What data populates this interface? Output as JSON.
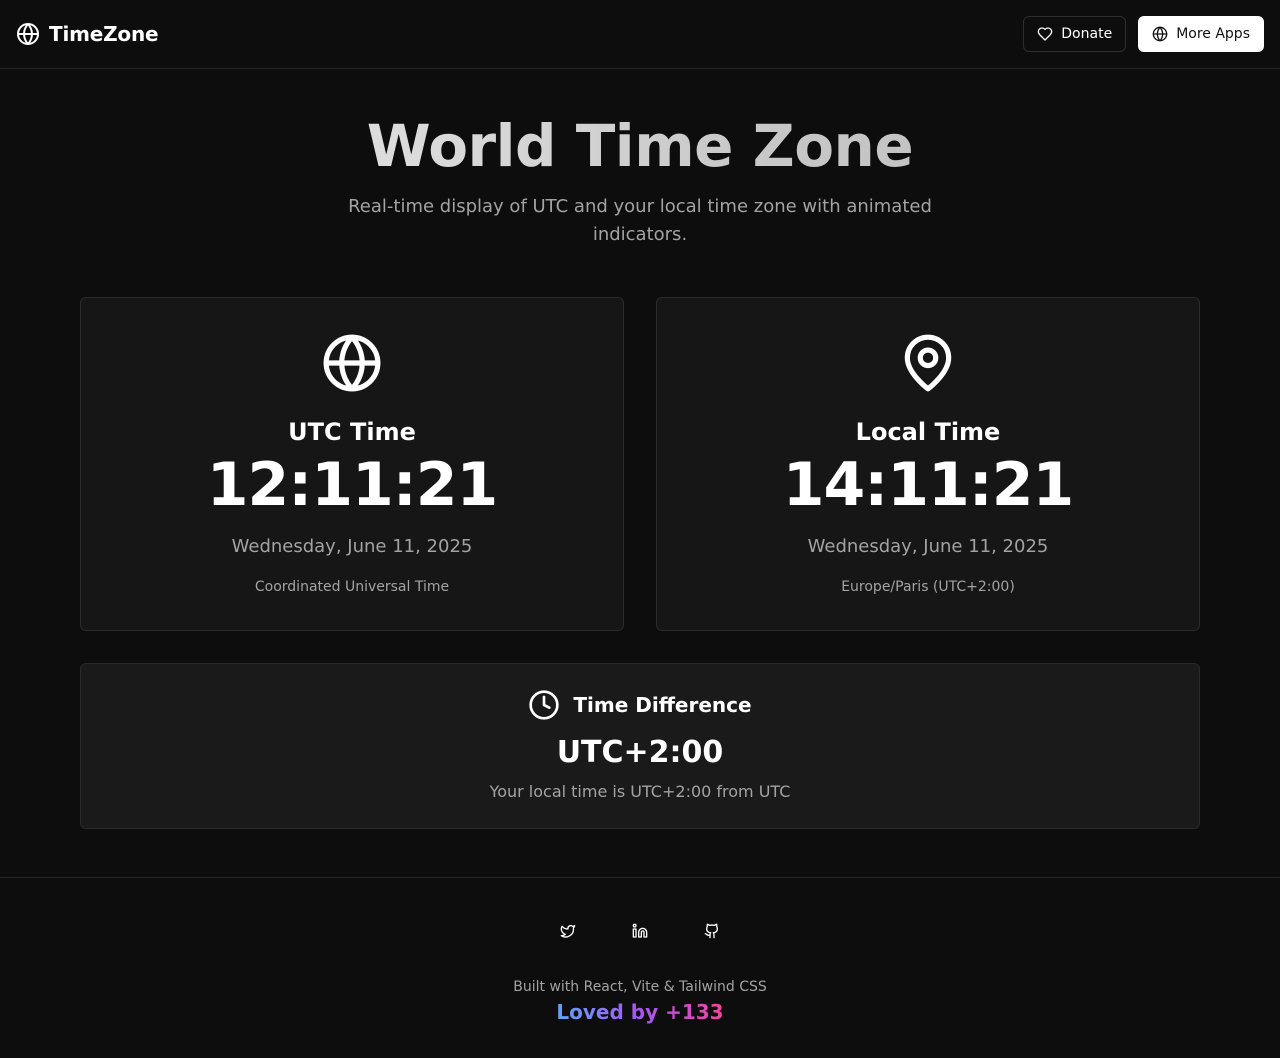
{
  "header": {
    "brand_name": "TimeZone",
    "donate_label": "Donate",
    "more_apps_label": "More Apps"
  },
  "hero": {
    "title": "World Time Zone",
    "subtitle": "Real-time display of UTC and your local time zone with animated indicators."
  },
  "utc_card": {
    "icon": "globe-icon",
    "title": "UTC Time",
    "time": "12:11:21",
    "date": "Wednesday, June 11, 2025",
    "zone": "Coordinated Universal Time"
  },
  "local_card": {
    "icon": "map-pin-icon",
    "title": "Local Time",
    "time": "14:11:21",
    "date": "Wednesday, June 11, 2025",
    "zone": "Europe/Paris (UTC+2:00)"
  },
  "difference": {
    "icon": "clock-icon",
    "title": "Time Difference",
    "value": "UTC+2:00",
    "note": "Your local time is UTC+2:00 from UTC"
  },
  "footer": {
    "social": [
      "twitter-icon",
      "linkedin-icon",
      "github-icon"
    ],
    "built_with": "Built with React, Vite & Tailwind CSS",
    "loved_by": "Loved by +133"
  },
  "colors": {
    "background": "#0d0d0d",
    "card": "#161616",
    "muted_text": "#a3a3a3",
    "loved_gradient": [
      "#60a5fa",
      "#a855f7",
      "#ec4899"
    ]
  }
}
